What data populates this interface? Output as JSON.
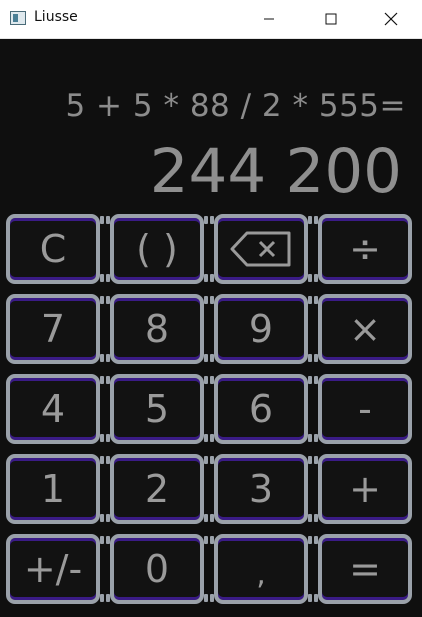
{
  "window": {
    "title": "Liusse"
  },
  "display": {
    "expression": "5 + 5 * 88 / 2 * 555=",
    "result": "244 200"
  },
  "keys": [
    [
      "C",
      "( )",
      "⌫",
      "÷"
    ],
    [
      "7",
      "8",
      "9",
      "×"
    ],
    [
      "4",
      "5",
      "6",
      "-"
    ],
    [
      "1",
      "2",
      "3",
      "+"
    ],
    [
      "+/-",
      "0",
      ",",
      "="
    ]
  ],
  "colors": {
    "background": "#0f0f0f",
    "key_border": "#9aa1aa",
    "key_accent": "#3a1b86",
    "text": "#9a9a9a"
  }
}
